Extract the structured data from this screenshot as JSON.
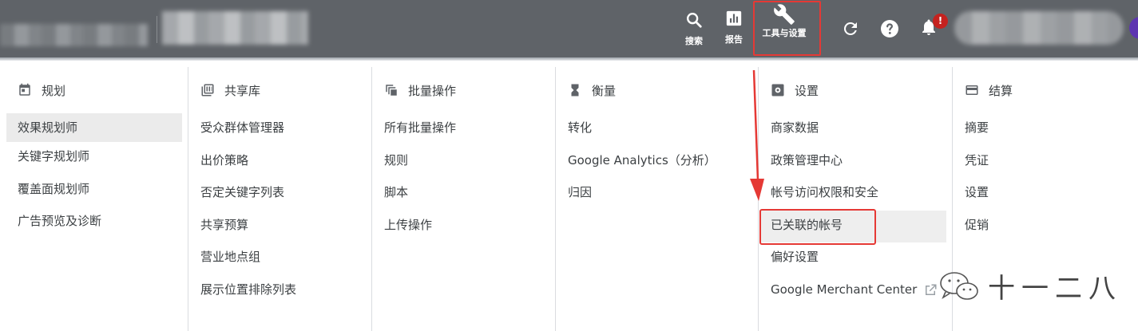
{
  "topbar": {
    "search_label": "搜索",
    "report_label": "报告",
    "tools_label": "工具与设置",
    "notification_badge": "!"
  },
  "colors": {
    "topbar_bg": "#5f6368",
    "highlight_red": "#e53935",
    "badge_red": "#c5221f",
    "avatar_purple": "#5e35b1"
  },
  "columns": [
    {
      "title": "规划",
      "icon": "calendar-icon",
      "items": [
        "效果规划师",
        "关键字规划师",
        "覆盖面规划师",
        "广告预览及诊断"
      ]
    },
    {
      "title": "共享库",
      "icon": "library-icon",
      "items": [
        "受众群体管理器",
        "出价策略",
        "否定关键字列表",
        "共享预算",
        "营业地点组",
        "展示位置排除列表"
      ]
    },
    {
      "title": "批量操作",
      "icon": "bulk-copy-icon",
      "items": [
        "所有批量操作",
        "规则",
        "脚本",
        "上传操作"
      ]
    },
    {
      "title": "衡量",
      "icon": "hourglass-icon",
      "items": [
        "转化",
        "Google Analytics（分析）",
        "归因"
      ]
    },
    {
      "title": "设置",
      "icon": "settings-icon",
      "items": [
        "商家数据",
        "政策管理中心",
        "帐号访问权限和安全",
        "已关联的帐号",
        "偏好设置",
        "Google Merchant Center"
      ]
    },
    {
      "title": "结算",
      "icon": "credit-card-icon",
      "items": [
        "摘要",
        "凭证",
        "设置",
        "促销"
      ]
    }
  ],
  "watermark": {
    "text": "十一二八",
    "icon": "wechat-icon"
  }
}
